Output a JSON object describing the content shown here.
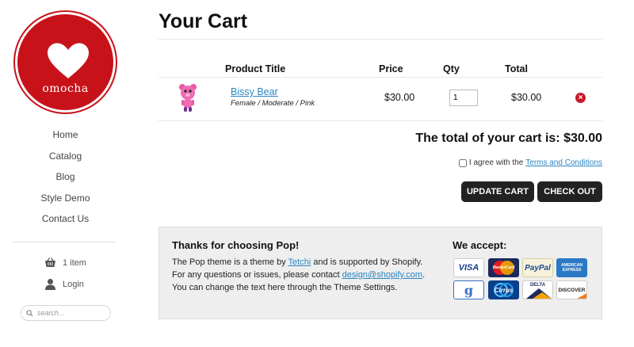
{
  "brand": {
    "name": "omocha"
  },
  "nav": [
    "Home",
    "Catalog",
    "Blog",
    "Style Demo",
    "Contact Us"
  ],
  "cart_link": "1 item",
  "login_link": "Login",
  "search": {
    "placeholder": "search..."
  },
  "page": {
    "title": "Your Cart"
  },
  "table": {
    "headers": {
      "product": "Product Title",
      "price": "Price",
      "qty": "Qty",
      "total": "Total"
    },
    "item": {
      "name": "Bissy Bear",
      "variant": "Female / Moderate / Pink",
      "price": "$30.00",
      "qty": "1",
      "total": "$30.00"
    }
  },
  "cart_total": "The total of your cart is: $30.00",
  "terms": {
    "prefix": "I agree with the",
    "link": "Terms and Conditions"
  },
  "buttons": {
    "update": "UPDATE CART",
    "checkout": "CHECK OUT"
  },
  "footer": {
    "heading": "Thanks for choosing Pop!",
    "line1_a": "The Pop theme is  a theme by",
    "line1_link": "Tetchi",
    "line1_b": "and is supported by Shopify.",
    "line2_a": "For any questions or issues, please contact",
    "line2_link": "design@shopify.com",
    "line2_b": ".",
    "line3": "You can change the text here through the Theme Settings.",
    "accept_heading": "We accept:",
    "cards": [
      {
        "label": "VISA",
        "icon": "visa-icon"
      },
      {
        "label": "MasterCard",
        "icon": "mastercard-icon"
      },
      {
        "label": "PayPal",
        "icon": "paypal-icon"
      },
      {
        "label": "AMERICAN EXPRESS",
        "icon": "amex-icon"
      },
      {
        "label": "g",
        "icon": "google-checkout-icon"
      },
      {
        "label": "Cirrus",
        "icon": "cirrus-icon"
      },
      {
        "label": "DELTA",
        "icon": "delta-icon"
      },
      {
        "label": "DISCOVER",
        "icon": "discover-icon"
      }
    ]
  },
  "colors": {
    "brand_red": "#c8121a",
    "link_blue": "#2a86c3",
    "button_dark": "#222222"
  }
}
